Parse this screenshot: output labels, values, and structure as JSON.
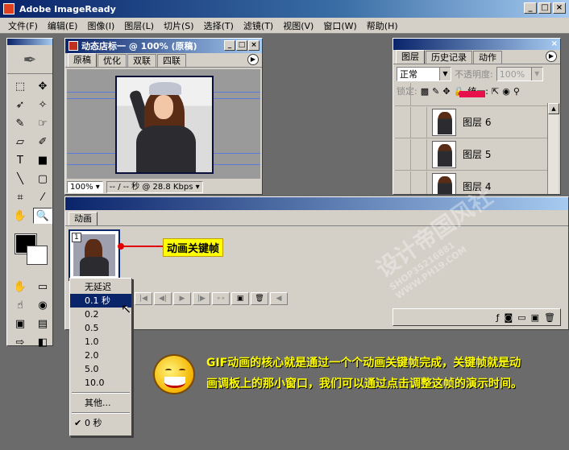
{
  "app": {
    "title": "Adobe ImageReady"
  },
  "menu": [
    "文件(F)",
    "编辑(E)",
    "图像(I)",
    "图层(L)",
    "切片(S)",
    "选择(T)",
    "滤镜(T)",
    "视图(V)",
    "窗口(W)",
    "帮助(H)"
  ],
  "document": {
    "title": "动态店标一 @ 100% (原稿)",
    "tabs": [
      "原稿",
      "优化",
      "双联",
      "四联"
    ],
    "zoom": "100%",
    "speed": "-- / -- 秒 @ 28.8 Kbps"
  },
  "layers_panel": {
    "tabs": [
      "图层",
      "历史记录",
      "动作"
    ],
    "blend_mode": "正常",
    "opacity_label": "不透明度:",
    "opacity_value": "100%",
    "lock_label": "锁定:",
    "unify_label": "统一:",
    "layers": [
      {
        "name": "图层 6"
      },
      {
        "name": "图层 5"
      },
      {
        "name": "图层 4"
      }
    ]
  },
  "animation_panel": {
    "tab": "动画",
    "frame_number": "1"
  },
  "annotation": {
    "label": "动画关键帧"
  },
  "delay_menu": {
    "items": [
      "无延迟",
      "0.1 秒",
      "0.2",
      "0.5",
      "1.0",
      "2.0",
      "5.0",
      "10.0"
    ],
    "selected_index": 1,
    "other": "其他...",
    "current": "0 秒"
  },
  "callout": {
    "text": "GIF动画的核心就是通过一个个动画关键帧完成，关键帧就是动画调板上的那小窗口，我们可以通过点击调整这帧的演示时间。"
  },
  "watermark": {
    "text": "设计帝国风社",
    "sub": "SHOP35216881 WWW.PH19.COM"
  },
  "colors": {
    "title_blue": "#0a246a",
    "callout_yellow": "#ffff00",
    "annotation_red": "#e00000",
    "menu_select": "#0a246a"
  }
}
